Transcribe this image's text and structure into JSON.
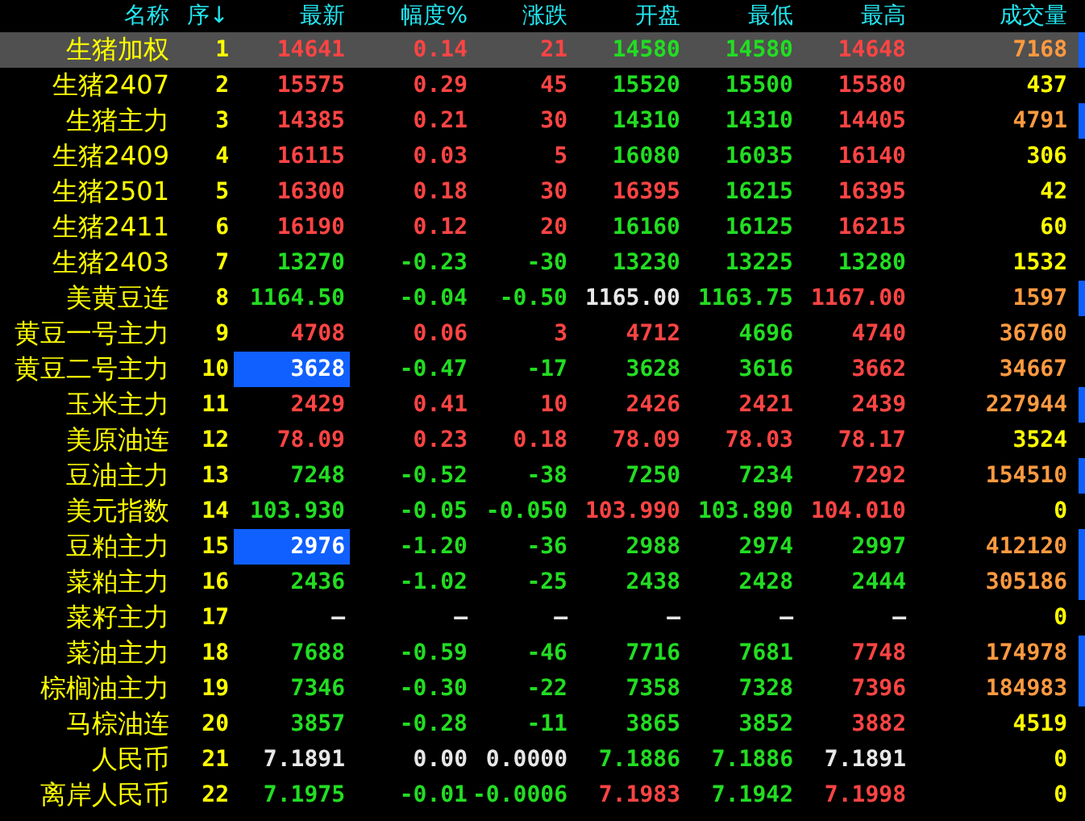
{
  "columns": [
    "名称",
    "序↓",
    "最新",
    "幅度%",
    "涨跌",
    "开盘",
    "最低",
    "最高",
    "成交量"
  ],
  "rows": [
    {
      "name": "生猪加权",
      "seq": "1",
      "selected": true,
      "marker": true,
      "latest_highlighted": false,
      "cells": [
        {
          "text": "14641",
          "color": "#ff4444"
        },
        {
          "text": "0.14",
          "color": "#ff4444"
        },
        {
          "text": "21",
          "color": "#ff4444"
        },
        {
          "text": "14580",
          "color": "#22dd22"
        },
        {
          "text": "14580",
          "color": "#22dd22"
        },
        {
          "text": "14648",
          "color": "#ff4444"
        },
        {
          "text": "7168",
          "color": "#ff9a40"
        }
      ]
    },
    {
      "name": "生猪2407",
      "seq": "2",
      "selected": false,
      "marker": false,
      "latest_highlighted": false,
      "cells": [
        {
          "text": "15575",
          "color": "#ff4444"
        },
        {
          "text": "0.29",
          "color": "#ff4444"
        },
        {
          "text": "45",
          "color": "#ff4444"
        },
        {
          "text": "15520",
          "color": "#22dd22"
        },
        {
          "text": "15500",
          "color": "#22dd22"
        },
        {
          "text": "15580",
          "color": "#ff4444"
        },
        {
          "text": "437",
          "color": "#ffff00"
        }
      ]
    },
    {
      "name": "生猪主力",
      "seq": "3",
      "selected": false,
      "marker": true,
      "latest_highlighted": false,
      "cells": [
        {
          "text": "14385",
          "color": "#ff4444"
        },
        {
          "text": "0.21",
          "color": "#ff4444"
        },
        {
          "text": "30",
          "color": "#ff4444"
        },
        {
          "text": "14310",
          "color": "#22dd22"
        },
        {
          "text": "14310",
          "color": "#22dd22"
        },
        {
          "text": "14405",
          "color": "#ff4444"
        },
        {
          "text": "4791",
          "color": "#ff9a40"
        }
      ]
    },
    {
      "name": "生猪2409",
      "seq": "4",
      "selected": false,
      "marker": false,
      "latest_highlighted": false,
      "cells": [
        {
          "text": "16115",
          "color": "#ff4444"
        },
        {
          "text": "0.03",
          "color": "#ff4444"
        },
        {
          "text": "5",
          "color": "#ff4444"
        },
        {
          "text": "16080",
          "color": "#22dd22"
        },
        {
          "text": "16035",
          "color": "#22dd22"
        },
        {
          "text": "16140",
          "color": "#ff4444"
        },
        {
          "text": "306",
          "color": "#ffff00"
        }
      ]
    },
    {
      "name": "生猪2501",
      "seq": "5",
      "selected": false,
      "marker": false,
      "latest_highlighted": false,
      "cells": [
        {
          "text": "16300",
          "color": "#ff4444"
        },
        {
          "text": "0.18",
          "color": "#ff4444"
        },
        {
          "text": "30",
          "color": "#ff4444"
        },
        {
          "text": "16395",
          "color": "#ff4444"
        },
        {
          "text": "16215",
          "color": "#22dd22"
        },
        {
          "text": "16395",
          "color": "#ff4444"
        },
        {
          "text": "42",
          "color": "#ffff00"
        }
      ]
    },
    {
      "name": "生猪2411",
      "seq": "6",
      "selected": false,
      "marker": false,
      "latest_highlighted": false,
      "cells": [
        {
          "text": "16190",
          "color": "#ff4444"
        },
        {
          "text": "0.12",
          "color": "#ff4444"
        },
        {
          "text": "20",
          "color": "#ff4444"
        },
        {
          "text": "16160",
          "color": "#22dd22"
        },
        {
          "text": "16125",
          "color": "#22dd22"
        },
        {
          "text": "16215",
          "color": "#ff4444"
        },
        {
          "text": "60",
          "color": "#ffff00"
        }
      ]
    },
    {
      "name": "生猪2403",
      "seq": "7",
      "selected": false,
      "marker": false,
      "latest_highlighted": false,
      "cells": [
        {
          "text": "13270",
          "color": "#22dd22"
        },
        {
          "text": "-0.23",
          "color": "#22dd22"
        },
        {
          "text": "-30",
          "color": "#22dd22"
        },
        {
          "text": "13230",
          "color": "#22dd22"
        },
        {
          "text": "13225",
          "color": "#22dd22"
        },
        {
          "text": "13280",
          "color": "#22dd22"
        },
        {
          "text": "1532",
          "color": "#ffff00"
        }
      ]
    },
    {
      "name": "美黄豆连",
      "seq": "8",
      "selected": false,
      "marker": true,
      "latest_highlighted": false,
      "cells": [
        {
          "text": "1164.50",
          "color": "#22dd22"
        },
        {
          "text": "-0.04",
          "color": "#22dd22"
        },
        {
          "text": "-0.50",
          "color": "#22dd22"
        },
        {
          "text": "1165.00",
          "color": "#e8e8e8"
        },
        {
          "text": "1163.75",
          "color": "#22dd22"
        },
        {
          "text": "1167.00",
          "color": "#ff4444"
        },
        {
          "text": "1597",
          "color": "#ff9a40"
        }
      ]
    },
    {
      "name": "黄豆一号主力",
      "seq": "9",
      "selected": false,
      "marker": false,
      "latest_highlighted": false,
      "cells": [
        {
          "text": "4708",
          "color": "#ff4444"
        },
        {
          "text": "0.06",
          "color": "#ff4444"
        },
        {
          "text": "3",
          "color": "#ff4444"
        },
        {
          "text": "4712",
          "color": "#ff4444"
        },
        {
          "text": "4696",
          "color": "#22dd22"
        },
        {
          "text": "4740",
          "color": "#ff4444"
        },
        {
          "text": "36760",
          "color": "#ff9a40"
        }
      ]
    },
    {
      "name": "黄豆二号主力",
      "seq": "10",
      "selected": false,
      "marker": false,
      "latest_highlighted": true,
      "cells": [
        {
          "text": "3628"
        },
        {
          "text": "-0.47",
          "color": "#22dd22"
        },
        {
          "text": "-17",
          "color": "#22dd22"
        },
        {
          "text": "3628",
          "color": "#22dd22"
        },
        {
          "text": "3616",
          "color": "#22dd22"
        },
        {
          "text": "3662",
          "color": "#ff4444"
        },
        {
          "text": "34667",
          "color": "#ff9a40"
        }
      ]
    },
    {
      "name": "玉米主力",
      "seq": "11",
      "selected": false,
      "marker": true,
      "latest_highlighted": false,
      "cells": [
        {
          "text": "2429",
          "color": "#ff4444"
        },
        {
          "text": "0.41",
          "color": "#ff4444"
        },
        {
          "text": "10",
          "color": "#ff4444"
        },
        {
          "text": "2426",
          "color": "#ff4444"
        },
        {
          "text": "2421",
          "color": "#ff4444"
        },
        {
          "text": "2439",
          "color": "#ff4444"
        },
        {
          "text": "227944",
          "color": "#ff9a40"
        }
      ]
    },
    {
      "name": "美原油连",
      "seq": "12",
      "selected": false,
      "marker": false,
      "latest_highlighted": false,
      "cells": [
        {
          "text": "78.09",
          "color": "#ff4444"
        },
        {
          "text": "0.23",
          "color": "#ff4444"
        },
        {
          "text": "0.18",
          "color": "#ff4444"
        },
        {
          "text": "78.09",
          "color": "#ff4444"
        },
        {
          "text": "78.03",
          "color": "#ff4444"
        },
        {
          "text": "78.17",
          "color": "#ff4444"
        },
        {
          "text": "3524",
          "color": "#ffff00"
        }
      ]
    },
    {
      "name": "豆油主力",
      "seq": "13",
      "selected": false,
      "marker": true,
      "latest_highlighted": false,
      "cells": [
        {
          "text": "7248",
          "color": "#22dd22"
        },
        {
          "text": "-0.52",
          "color": "#22dd22"
        },
        {
          "text": "-38",
          "color": "#22dd22"
        },
        {
          "text": "7250",
          "color": "#22dd22"
        },
        {
          "text": "7234",
          "color": "#22dd22"
        },
        {
          "text": "7292",
          "color": "#ff4444"
        },
        {
          "text": "154510",
          "color": "#ff9a40"
        }
      ]
    },
    {
      "name": "美元指数",
      "seq": "14",
      "selected": false,
      "marker": false,
      "latest_highlighted": false,
      "cells": [
        {
          "text": "103.930",
          "color": "#22dd22"
        },
        {
          "text": "-0.05",
          "color": "#22dd22"
        },
        {
          "text": "-0.050",
          "color": "#22dd22"
        },
        {
          "text": "103.990",
          "color": "#ff4444"
        },
        {
          "text": "103.890",
          "color": "#22dd22"
        },
        {
          "text": "104.010",
          "color": "#ff4444"
        },
        {
          "text": "0",
          "color": "#ffff00"
        }
      ]
    },
    {
      "name": "豆粕主力",
      "seq": "15",
      "selected": false,
      "marker": true,
      "latest_highlighted": true,
      "cells": [
        {
          "text": "2976"
        },
        {
          "text": "-1.20",
          "color": "#22dd22"
        },
        {
          "text": "-36",
          "color": "#22dd22"
        },
        {
          "text": "2988",
          "color": "#22dd22"
        },
        {
          "text": "2974",
          "color": "#22dd22"
        },
        {
          "text": "2997",
          "color": "#22dd22"
        },
        {
          "text": "412120",
          "color": "#ff9a40"
        }
      ]
    },
    {
      "name": "菜粕主力",
      "seq": "16",
      "selected": false,
      "marker": true,
      "latest_highlighted": false,
      "cells": [
        {
          "text": "2436",
          "color": "#22dd22"
        },
        {
          "text": "-1.02",
          "color": "#22dd22"
        },
        {
          "text": "-25",
          "color": "#22dd22"
        },
        {
          "text": "2438",
          "color": "#22dd22"
        },
        {
          "text": "2428",
          "color": "#22dd22"
        },
        {
          "text": "2444",
          "color": "#22dd22"
        },
        {
          "text": "305186",
          "color": "#ff9a40"
        }
      ]
    },
    {
      "name": "菜籽主力",
      "seq": "17",
      "selected": false,
      "marker": false,
      "latest_highlighted": false,
      "cells": [
        {
          "text": "—",
          "color": "#e8e8e8"
        },
        {
          "text": "—",
          "color": "#e8e8e8"
        },
        {
          "text": "—",
          "color": "#e8e8e8"
        },
        {
          "text": "—",
          "color": "#e8e8e8"
        },
        {
          "text": "—",
          "color": "#e8e8e8"
        },
        {
          "text": "—",
          "color": "#e8e8e8"
        },
        {
          "text": "0",
          "color": "#ffff00"
        }
      ]
    },
    {
      "name": "菜油主力",
      "seq": "18",
      "selected": false,
      "marker": true,
      "latest_highlighted": false,
      "cells": [
        {
          "text": "7688",
          "color": "#22dd22"
        },
        {
          "text": "-0.59",
          "color": "#22dd22"
        },
        {
          "text": "-46",
          "color": "#22dd22"
        },
        {
          "text": "7716",
          "color": "#22dd22"
        },
        {
          "text": "7681",
          "color": "#22dd22"
        },
        {
          "text": "7748",
          "color": "#ff4444"
        },
        {
          "text": "174978",
          "color": "#ff9a40"
        }
      ]
    },
    {
      "name": "棕榈油主力",
      "seq": "19",
      "selected": false,
      "marker": true,
      "latest_highlighted": false,
      "cells": [
        {
          "text": "7346",
          "color": "#22dd22"
        },
        {
          "text": "-0.30",
          "color": "#22dd22"
        },
        {
          "text": "-22",
          "color": "#22dd22"
        },
        {
          "text": "7358",
          "color": "#22dd22"
        },
        {
          "text": "7328",
          "color": "#22dd22"
        },
        {
          "text": "7396",
          "color": "#ff4444"
        },
        {
          "text": "184983",
          "color": "#ff9a40"
        }
      ]
    },
    {
      "name": "马棕油连",
      "seq": "20",
      "selected": false,
      "marker": false,
      "latest_highlighted": false,
      "cells": [
        {
          "text": "3857",
          "color": "#22dd22"
        },
        {
          "text": "-0.28",
          "color": "#22dd22"
        },
        {
          "text": "-11",
          "color": "#22dd22"
        },
        {
          "text": "3865",
          "color": "#22dd22"
        },
        {
          "text": "3852",
          "color": "#22dd22"
        },
        {
          "text": "3882",
          "color": "#ff4444"
        },
        {
          "text": "4519",
          "color": "#ffff00"
        }
      ]
    },
    {
      "name": "人民币",
      "seq": "21",
      "selected": false,
      "marker": false,
      "latest_highlighted": false,
      "cells": [
        {
          "text": "7.1891",
          "color": "#e8e8e8"
        },
        {
          "text": "0.00",
          "color": "#e8e8e8"
        },
        {
          "text": "0.0000",
          "color": "#e8e8e8"
        },
        {
          "text": "7.1886",
          "color": "#22dd22"
        },
        {
          "text": "7.1886",
          "color": "#22dd22"
        },
        {
          "text": "7.1891",
          "color": "#e8e8e8"
        },
        {
          "text": "0",
          "color": "#ffff00"
        }
      ]
    },
    {
      "name": "离岸人民币",
      "seq": "22",
      "selected": false,
      "marker": false,
      "latest_highlighted": false,
      "cells": [
        {
          "text": "7.1975",
          "color": "#22dd22"
        },
        {
          "text": "-0.01",
          "color": "#22dd22"
        },
        {
          "text": "-0.0006",
          "color": "#22dd22"
        },
        {
          "text": "7.1983",
          "color": "#ff4444"
        },
        {
          "text": "7.1942",
          "color": "#22dd22"
        },
        {
          "text": "7.1998",
          "color": "#ff4444"
        },
        {
          "text": "0",
          "color": "#ffff00"
        }
      ]
    }
  ]
}
